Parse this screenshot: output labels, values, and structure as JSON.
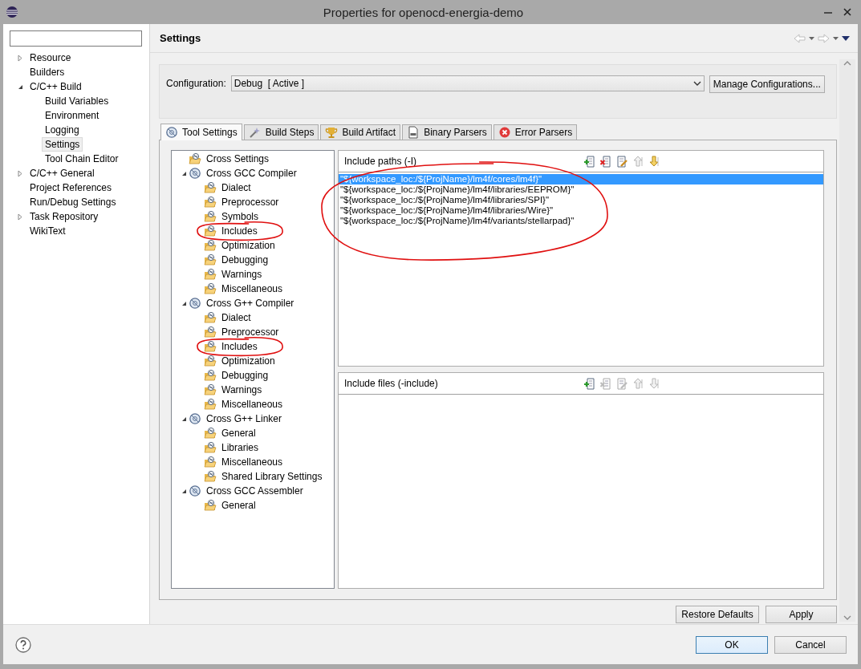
{
  "window": {
    "title": "Properties for openocd-energia-demo"
  },
  "sidebar": {
    "items": [
      {
        "label": "Resource",
        "kind": "node",
        "expanded": false,
        "selected": false
      },
      {
        "label": "Builders",
        "kind": "leaf",
        "selected": false
      },
      {
        "label": "C/C++ Build",
        "kind": "node",
        "expanded": true,
        "selected": false,
        "children": [
          {
            "label": "Build Variables",
            "kind": "leaf",
            "selected": false
          },
          {
            "label": "Environment",
            "kind": "leaf",
            "selected": false
          },
          {
            "label": "Logging",
            "kind": "leaf",
            "selected": false
          },
          {
            "label": "Settings",
            "kind": "leaf",
            "selected": true
          },
          {
            "label": "Tool Chain Editor",
            "kind": "leaf",
            "selected": false
          }
        ]
      },
      {
        "label": "C/C++ General",
        "kind": "node",
        "expanded": false,
        "selected": false
      },
      {
        "label": "Project References",
        "kind": "leaf",
        "selected": false
      },
      {
        "label": "Run/Debug Settings",
        "kind": "leaf",
        "selected": false
      },
      {
        "label": "Task Repository",
        "kind": "node",
        "expanded": false,
        "selected": false
      },
      {
        "label": "WikiText",
        "kind": "leaf",
        "selected": false
      }
    ]
  },
  "page_title": "Settings",
  "configuration": {
    "label": "Configuration:",
    "value": "Debug  [ Active ]",
    "button": "Manage Configurations..."
  },
  "tabs": [
    {
      "label": "Tool Settings",
      "selected": true
    },
    {
      "label": "Build Steps",
      "selected": false
    },
    {
      "label": "Build Artifact",
      "selected": false
    },
    {
      "label": "Binary Parsers",
      "selected": false
    },
    {
      "label": "Error Parsers",
      "selected": false
    }
  ],
  "tool_tree": [
    {
      "label": "Cross Settings",
      "kind": "leaf",
      "annotated": false
    },
    {
      "label": "Cross GCC Compiler",
      "kind": "node",
      "expanded": true,
      "children": [
        {
          "label": "Dialect",
          "kind": "leaf",
          "annotated": false
        },
        {
          "label": "Preprocessor",
          "kind": "leaf",
          "annotated": false
        },
        {
          "label": "Symbols",
          "kind": "leaf",
          "annotated": false
        },
        {
          "label": "Includes",
          "kind": "leaf",
          "annotated": true
        },
        {
          "label": "Optimization",
          "kind": "leaf",
          "annotated": false
        },
        {
          "label": "Debugging",
          "kind": "leaf",
          "annotated": false
        },
        {
          "label": "Warnings",
          "kind": "leaf",
          "annotated": false
        },
        {
          "label": "Miscellaneous",
          "kind": "leaf",
          "annotated": false
        }
      ]
    },
    {
      "label": "Cross G++ Compiler",
      "kind": "node",
      "expanded": true,
      "children": [
        {
          "label": "Dialect",
          "kind": "leaf",
          "annotated": false
        },
        {
          "label": "Preprocessor",
          "kind": "leaf",
          "annotated": false
        },
        {
          "label": "Includes",
          "kind": "leaf",
          "annotated": true
        },
        {
          "label": "Optimization",
          "kind": "leaf",
          "annotated": false
        },
        {
          "label": "Debugging",
          "kind": "leaf",
          "annotated": false
        },
        {
          "label": "Warnings",
          "kind": "leaf",
          "annotated": false
        },
        {
          "label": "Miscellaneous",
          "kind": "leaf",
          "annotated": false
        }
      ]
    },
    {
      "label": "Cross G++ Linker",
      "kind": "node",
      "expanded": true,
      "children": [
        {
          "label": "General",
          "kind": "leaf",
          "annotated": false
        },
        {
          "label": "Libraries",
          "kind": "leaf",
          "annotated": false
        },
        {
          "label": "Miscellaneous",
          "kind": "leaf",
          "annotated": false
        },
        {
          "label": "Shared Library Settings",
          "kind": "leaf",
          "annotated": false
        }
      ]
    },
    {
      "label": "Cross GCC Assembler",
      "kind": "node",
      "expanded": true,
      "children": [
        {
          "label": "General",
          "kind": "leaf",
          "annotated": false
        }
      ]
    }
  ],
  "include_paths": {
    "title": "Include paths (-I)",
    "annotated": true,
    "tools": [
      {
        "disabled": false
      },
      {
        "disabled": false
      },
      {
        "disabled": false
      },
      {
        "disabled": true
      },
      {
        "disabled": false
      }
    ],
    "rows": [
      {
        "text": "\"${workspace_loc:/${ProjName}/lm4f/cores/lm4f}\"",
        "selected": true
      },
      {
        "text": "\"${workspace_loc:/${ProjName}/lm4f/libraries/EEPROM}\"",
        "selected": false
      },
      {
        "text": "\"${workspace_loc:/${ProjName}/lm4f/libraries/SPI}\"",
        "selected": false
      },
      {
        "text": "\"${workspace_loc:/${ProjName}/lm4f/libraries/Wire}\"",
        "selected": false
      },
      {
        "text": "\"${workspace_loc:/${ProjName}/lm4f/variants/stellarpad}\"",
        "selected": false
      }
    ]
  },
  "include_files": {
    "title": "Include files (-include)",
    "tools": [
      {
        "disabled": false
      },
      {
        "disabled": true
      },
      {
        "disabled": true
      },
      {
        "disabled": true
      },
      {
        "disabled": true
      }
    ]
  },
  "buttons": {
    "restore": "Restore Defaults",
    "apply": "Apply",
    "ok": "OK",
    "cancel": "Cancel"
  }
}
